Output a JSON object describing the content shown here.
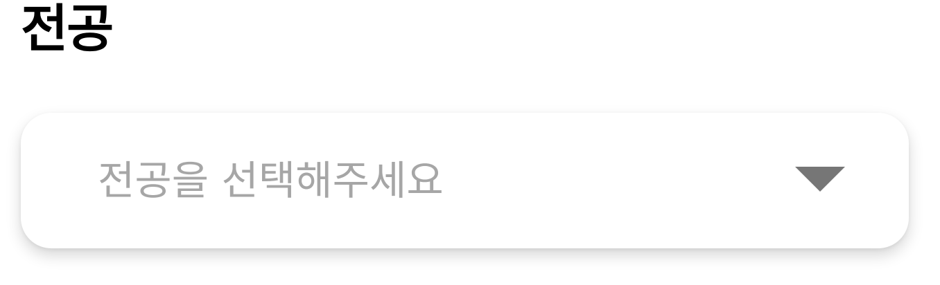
{
  "section": {
    "title": "전공"
  },
  "major_select": {
    "placeholder": "전공을 선택해주세요",
    "value": "",
    "icon": "triangle-down-icon"
  },
  "colors": {
    "title": "#000000",
    "placeholder": "#a6a6a6",
    "icon": "#767676",
    "background": "#ffffff"
  }
}
